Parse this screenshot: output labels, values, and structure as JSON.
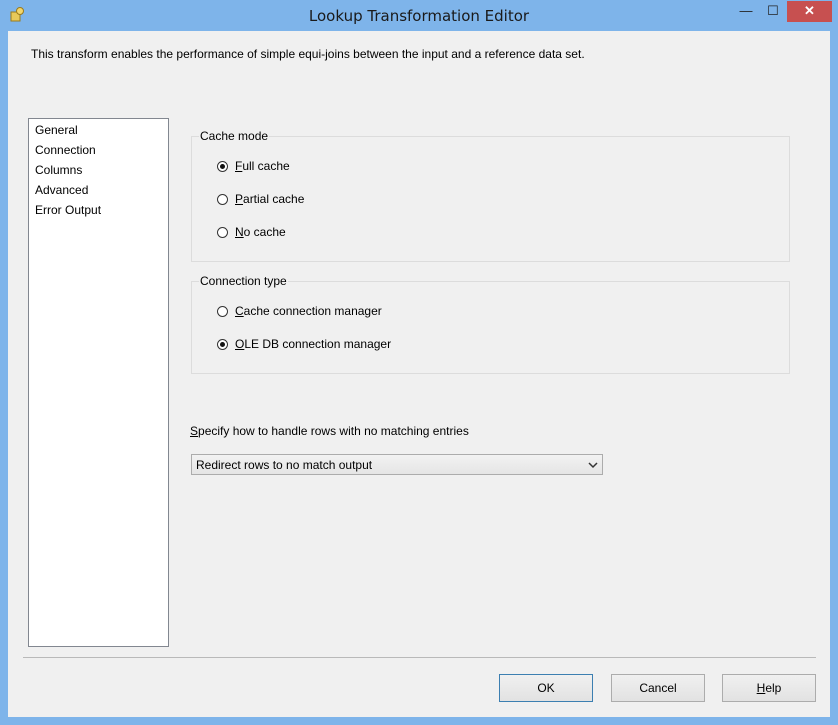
{
  "window": {
    "title": "Lookup Transformation Editor",
    "minimize": "—",
    "maximize": "☐",
    "close": "✕"
  },
  "description": "This transform enables the performance of simple equi-joins between the input and a reference data set.",
  "nav": {
    "items": [
      "General",
      "Connection",
      "Columns",
      "Advanced",
      "Error Output"
    ]
  },
  "cache_mode": {
    "label": "Cache mode",
    "options": [
      {
        "key": "F",
        "rest": "ull cache",
        "checked": true
      },
      {
        "key": "P",
        "rest": "artial cache",
        "checked": false
      },
      {
        "key": "N",
        "rest": "o cache",
        "checked": false
      }
    ]
  },
  "connection_type": {
    "label": "Connection type",
    "options": [
      {
        "key": "C",
        "rest": "ache connection manager",
        "checked": false
      },
      {
        "key": "O",
        "rest": "LE DB connection manager",
        "checked": true
      }
    ]
  },
  "no_match": {
    "label_key": "S",
    "label_rest": "pecify how to handle rows with no matching entries",
    "selected": "Redirect rows to no match output"
  },
  "buttons": {
    "ok": "OK",
    "cancel": "Cancel",
    "help_key": "H",
    "help_rest": "elp"
  }
}
